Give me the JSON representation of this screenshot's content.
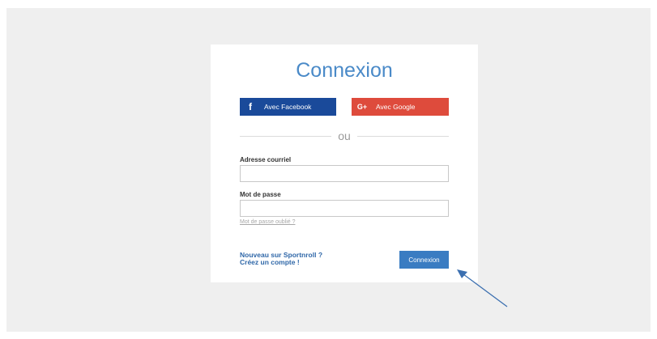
{
  "login": {
    "title": "Connexion",
    "facebook_label": "Avec Facebook",
    "facebook_icon": "f",
    "google_label": "Avec Google",
    "google_icon": "G+",
    "divider_text": "ou",
    "email_label": "Adresse courriel",
    "email_value": "",
    "password_label": "Mot de passe",
    "password_value": "",
    "forgot_link": "Mot de passe oublié ?",
    "signup_line1": "Nouveau sur Sportnroll ?",
    "signup_line2": "Créez un compte !",
    "submit_label": "Connexion"
  },
  "colors": {
    "brand_blue": "#4a8ac8",
    "facebook": "#1a4a9a",
    "google": "#de4b3c",
    "button": "#3a7cc2",
    "annotation_arrow": "#3b6fb0"
  },
  "annotation": {
    "icon": "pointer-arrow-icon"
  }
}
